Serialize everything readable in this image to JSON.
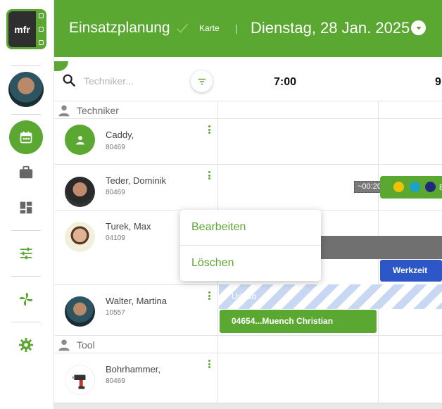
{
  "header": {
    "title": "Einsatzplanung",
    "karte_label": "Karte",
    "separator": "|",
    "date": "Dienstag, 28 Jan. 2025"
  },
  "logo": {
    "text": "mfr"
  },
  "search": {
    "placeholder": "Techniker..."
  },
  "timeline": {
    "hours": [
      "7:00",
      "9"
    ]
  },
  "sections": [
    {
      "label": "Techniker",
      "icon": "person-icon"
    },
    {
      "label": "Tool",
      "icon": "person-icon"
    }
  ],
  "rows": [
    {
      "name": "Caddy,",
      "id": "80469"
    },
    {
      "name": "Teder, Dominik",
      "id": "80469"
    },
    {
      "name": "Turek, Max",
      "id": "04109"
    },
    {
      "name": "Walter, Martina",
      "id": "10557"
    },
    {
      "name": "Bohrhammer,",
      "id": "80469"
    }
  ],
  "events": {
    "teder_duration": "~00:20",
    "teder_more": "8",
    "werkzeit": "Werkzeit",
    "urlaub": "Urlaub",
    "job": "04654...Muench Christian"
  },
  "context_menu": {
    "edit": "Bearbeiten",
    "delete": "Löschen"
  },
  "colors": {
    "brand_green": "#5aa831",
    "werkzeit_blue": "#2d57c6",
    "dot_yellow": "#f2c200",
    "dot_teal": "#1aa3c4",
    "dot_navy": "#1f2a7a"
  }
}
